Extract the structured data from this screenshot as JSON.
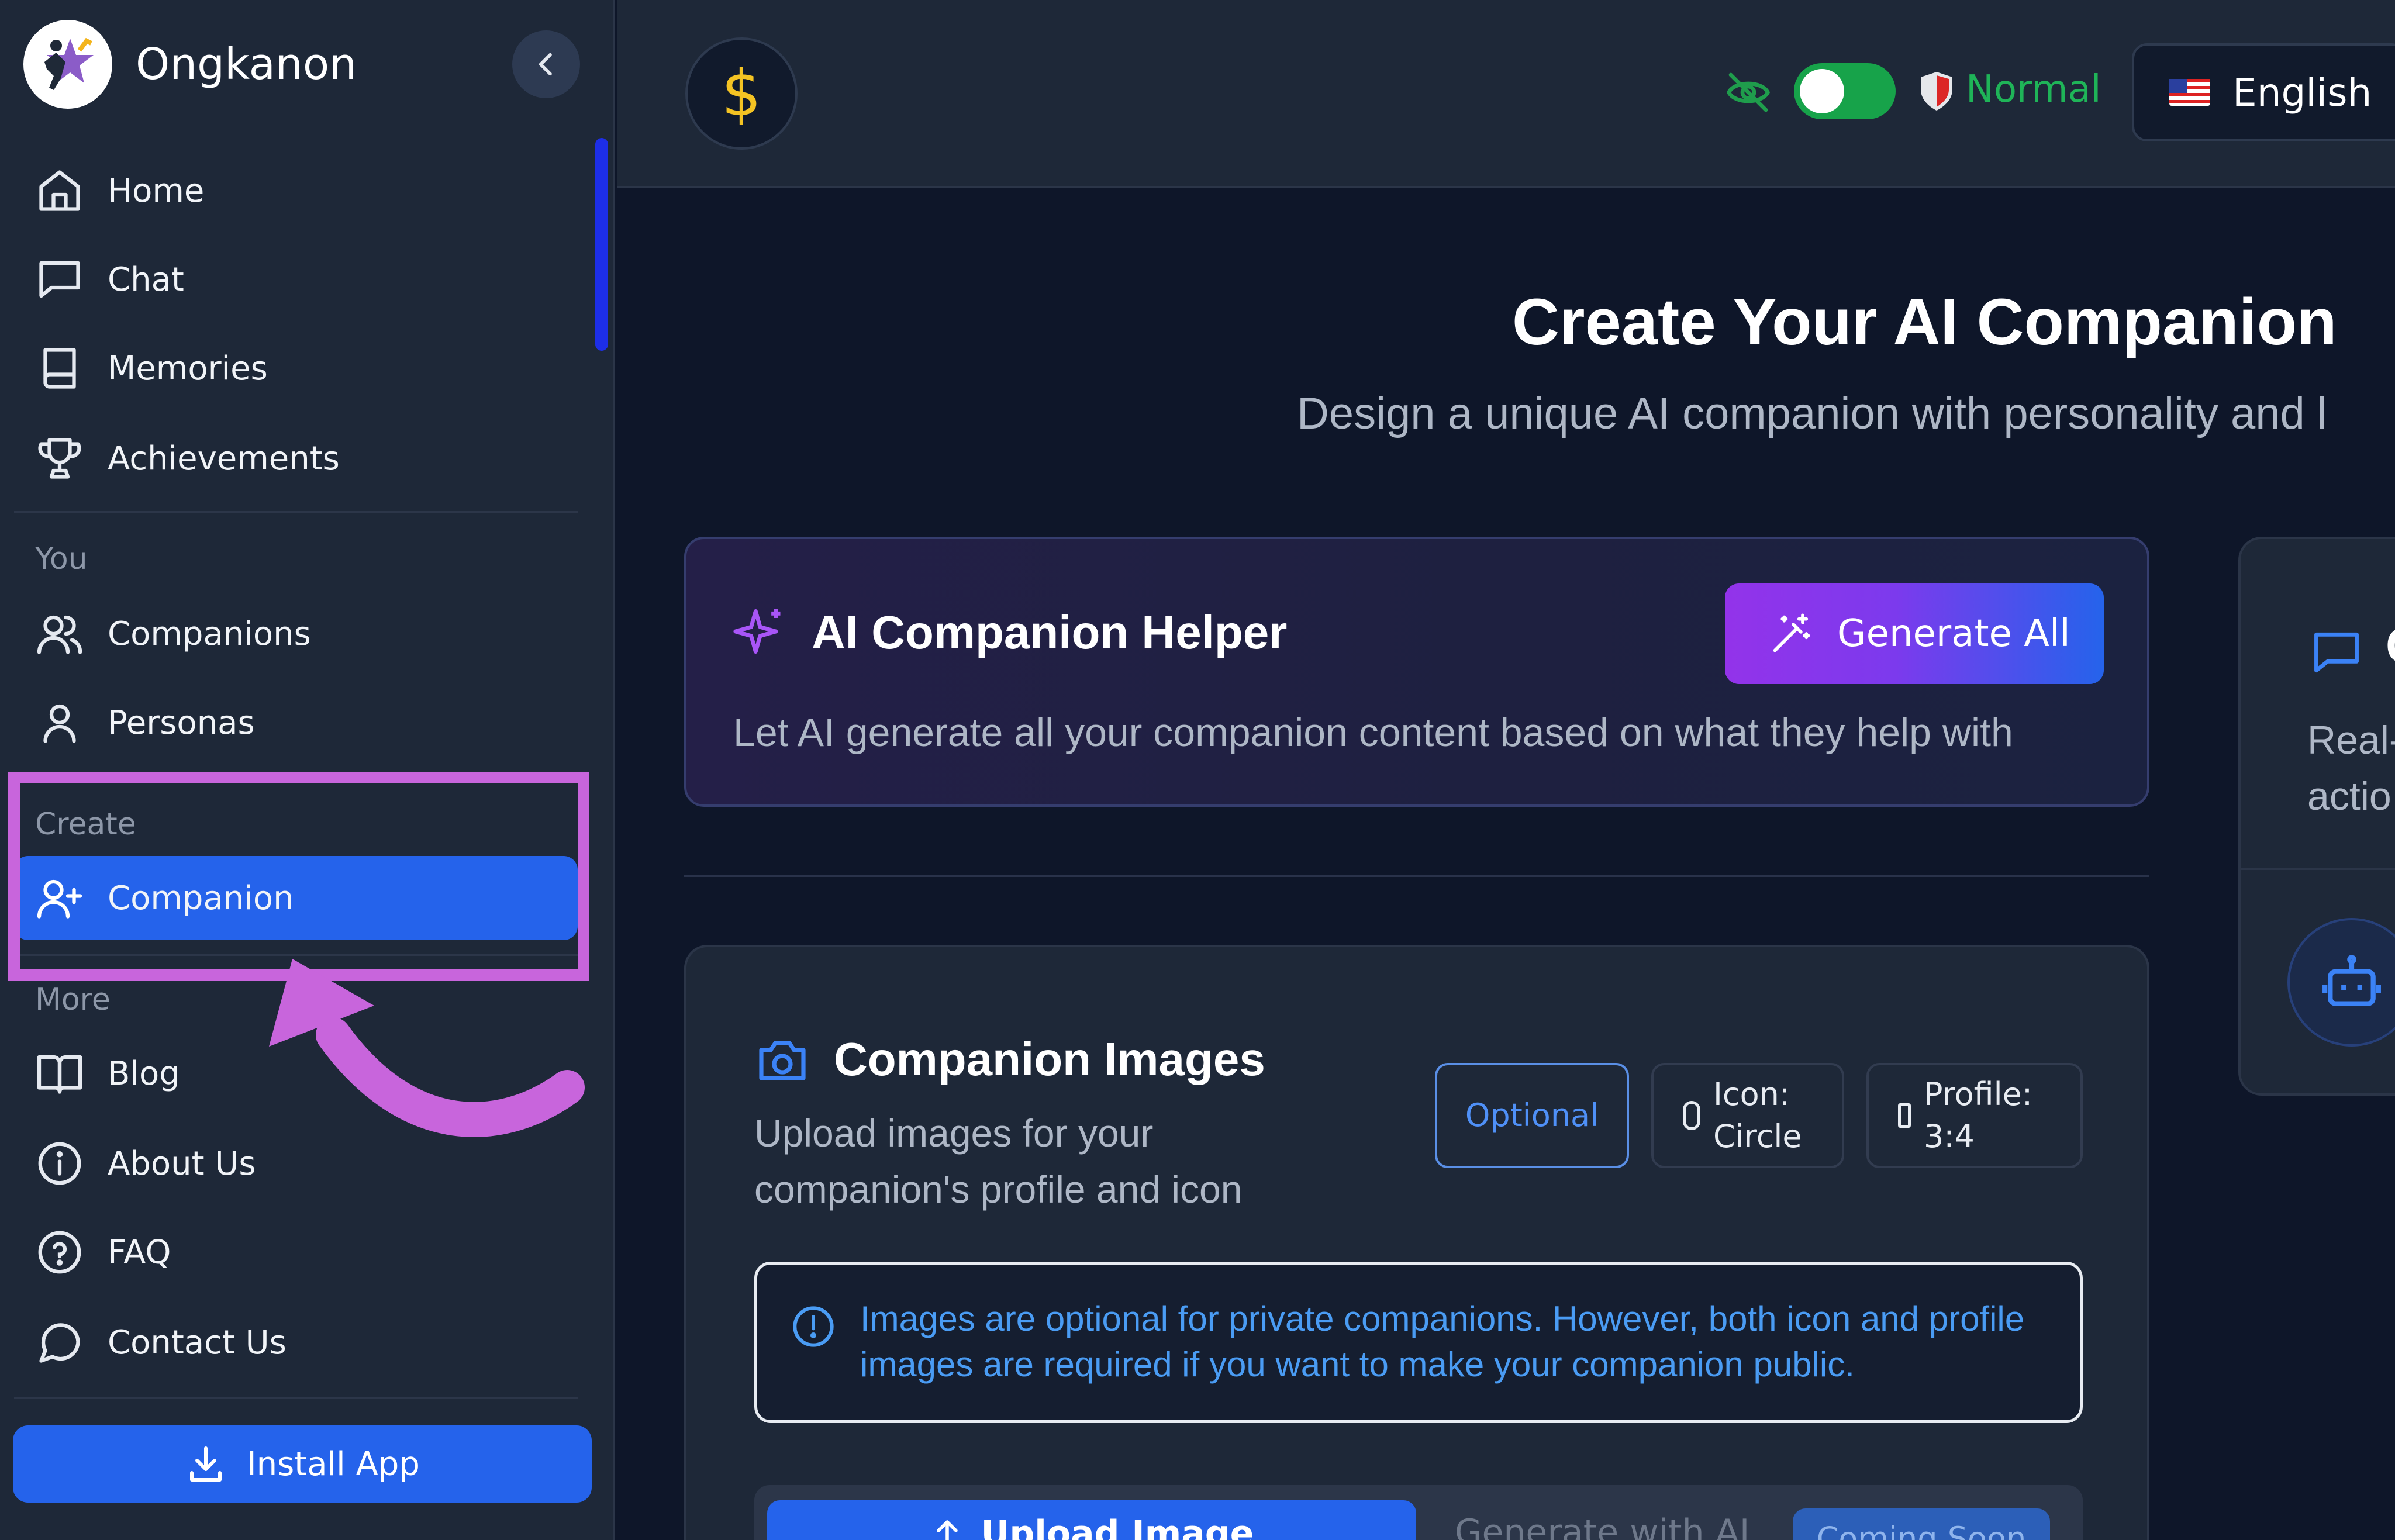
{
  "app": {
    "name": "Ongkanon"
  },
  "sidebar": {
    "items_main": [
      {
        "label": "Home",
        "icon": "home-icon"
      },
      {
        "label": "Chat",
        "icon": "chat-icon"
      },
      {
        "label": "Memories",
        "icon": "book-icon"
      },
      {
        "label": "Achievements",
        "icon": "trophy-icon"
      }
    ],
    "section_you": "You",
    "items_you": [
      {
        "label": "Companions",
        "icon": "users-icon"
      },
      {
        "label": "Personas",
        "icon": "user-icon"
      }
    ],
    "section_create": "Create",
    "items_create": [
      {
        "label": "Companion",
        "icon": "user-plus-icon",
        "active": true
      }
    ],
    "section_more": "More",
    "items_more": [
      {
        "label": "Blog",
        "icon": "open-book-icon"
      },
      {
        "label": "About Us",
        "icon": "info-icon"
      },
      {
        "label": "FAQ",
        "icon": "help-icon"
      },
      {
        "label": "Contact Us",
        "icon": "message-circle-icon"
      }
    ],
    "install_label": "Install App"
  },
  "header": {
    "currency_symbol": "$",
    "mode_label": "Normal",
    "language": "English"
  },
  "main": {
    "title": "Create Your AI Companion",
    "subtitle": "Design a unique AI companion with personality and l",
    "helper": {
      "title": "AI Companion Helper",
      "button": "Generate All",
      "description": "Let AI generate all your companion content based on what they help with"
    },
    "images": {
      "title": "Companion Images",
      "description": "Upload images for your companion's profile and icon",
      "badges": {
        "optional": "Optional",
        "icon_line1": "Icon:",
        "icon_line2": "Circle",
        "profile_line1": "Profile:",
        "profile_line2": "3:4"
      },
      "info": "Images are optional for private companions. However, both icon and profile images are required if you want to make your companion public.",
      "tab_upload": "Upload Image",
      "tab_generate": "Generate with AI",
      "coming_soon": "Coming Soon"
    },
    "side_card": {
      "title_fragment": "C",
      "line1": "Real-",
      "line2": "actio"
    }
  },
  "colors": {
    "accent": "#2563eb",
    "highlight": "#c865dc",
    "toggle_on": "#17a34a",
    "coin": "#f4c323",
    "purple": "#9333ea"
  }
}
